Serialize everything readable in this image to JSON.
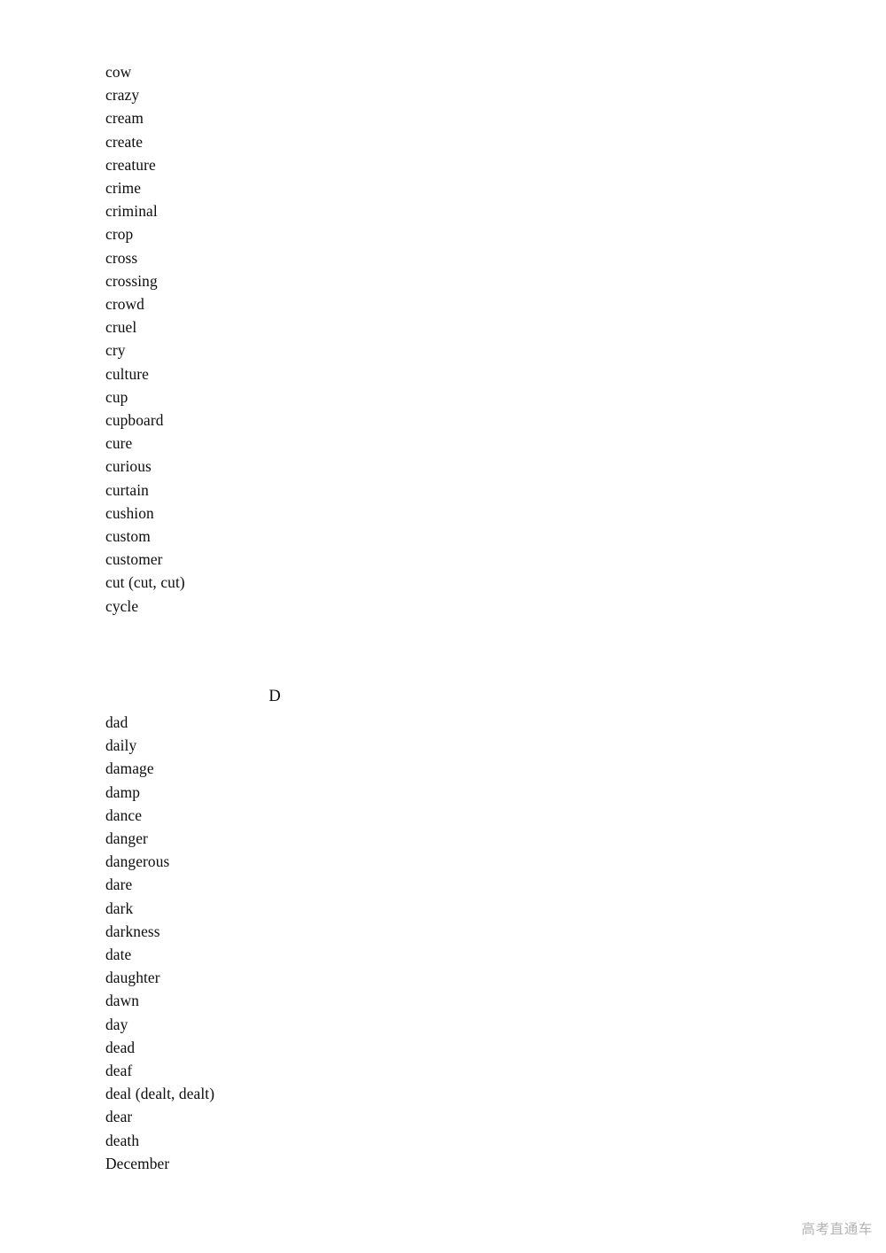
{
  "document": {
    "type": "vocabulary-word-list",
    "background_color": "#ffffff",
    "text_color": "#0d0d0d"
  },
  "sections": [
    {
      "id": "section-c-continued",
      "heading": null,
      "words": [
        "cow",
        "crazy",
        "cream",
        "create",
        "creature",
        "crime",
        "criminal",
        "crop",
        "cross",
        "crossing",
        "crowd",
        "cruel",
        "cry",
        "culture",
        "cup",
        "cupboard",
        "cure",
        "curious",
        "curtain",
        "cushion",
        "custom",
        "customer",
        "cut (cut, cut)",
        "cycle"
      ]
    },
    {
      "id": "section-d",
      "heading": "D",
      "words": [
        "dad",
        "daily",
        "damage",
        "damp",
        "dance",
        "danger",
        "dangerous",
        "dare",
        "dark",
        "darkness",
        "date",
        "daughter",
        "dawn",
        "day",
        "dead",
        "deaf",
        "deal (dealt, dealt)",
        "dear",
        "death",
        "December"
      ]
    }
  ],
  "watermark": {
    "text": "高考直通车",
    "color": "#b3b3b3"
  }
}
